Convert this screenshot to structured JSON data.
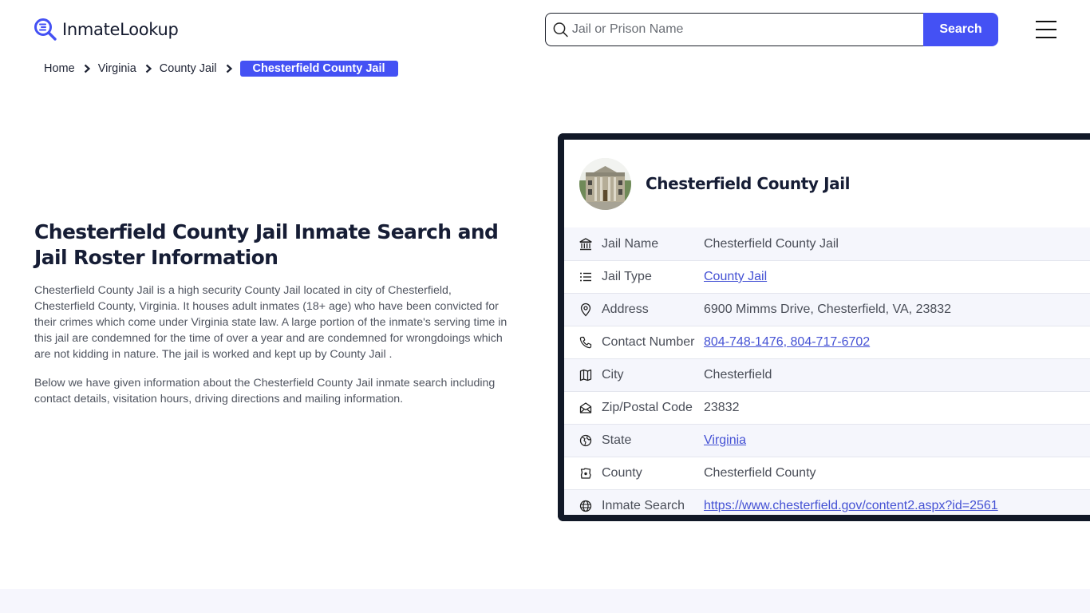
{
  "header": {
    "logo_text": "InmateLookup",
    "search": {
      "placeholder": "Jail or Prison Name",
      "value": "",
      "button_label": "Search"
    },
    "menu_icon": "hamburger-menu-icon"
  },
  "breadcrumb": {
    "items": [
      {
        "label": "Home"
      },
      {
        "label": "Virginia"
      },
      {
        "label": "County Jail"
      }
    ],
    "current": "Chesterfield County Jail"
  },
  "main": {
    "title": "Chesterfield County Jail Inmate Search and Jail Roster Information",
    "paragraphs": [
      "Chesterfield County Jail is a high security County Jail located in city of Chesterfield, Chesterfield County, Virginia. It houses adult inmates (18+ age) who have been convicted for their crimes which come under Virginia state law. A large portion of the inmate's serving time in this jail are condemned for the time of over a year and are condemned for wrongdoings which are not kidding in nature. The jail is worked and kept up by County Jail .",
      "Below we have given information about the Chesterfield County Jail inmate search including contact details, visitation hours, driving directions and mailing information."
    ]
  },
  "card": {
    "title": "Chesterfield County Jail",
    "image_alt": "Chesterfield County Jail building",
    "rows": [
      {
        "icon": "bank-building-icon",
        "label": "Jail Name",
        "value": "Chesterfield County Jail",
        "link": false
      },
      {
        "icon": "list-icon",
        "label": "Jail Type",
        "value": "County Jail",
        "link": true
      },
      {
        "icon": "map-pin-icon",
        "label": "Address",
        "value": "6900 Mimms Drive, Chesterfield, VA, 23832",
        "link": false
      },
      {
        "icon": "phone-icon",
        "label": "Contact Number",
        "value": "804-748-1476, 804-717-6702",
        "link": true
      },
      {
        "icon": "map-icon",
        "label": "City",
        "value": "Chesterfield",
        "link": false
      },
      {
        "icon": "mail-open-icon",
        "label": "Zip/Postal Code",
        "value": "23832",
        "link": false
      },
      {
        "icon": "globe-state-icon",
        "label": "State",
        "value": "Virginia",
        "link": true
      },
      {
        "icon": "county-map-icon",
        "label": "County",
        "value": "Chesterfield County",
        "link": false
      },
      {
        "icon": "world-icon",
        "label": "Inmate Search",
        "value": "https://www.chesterfield.gov/content2.aspx?id=2561",
        "link": true
      }
    ]
  },
  "colors": {
    "accent": "#4451f4",
    "card_border": "#111827",
    "link": "#4451d4",
    "row_alt": "#f5f6fc",
    "footer_band": "#f6f6fd"
  }
}
